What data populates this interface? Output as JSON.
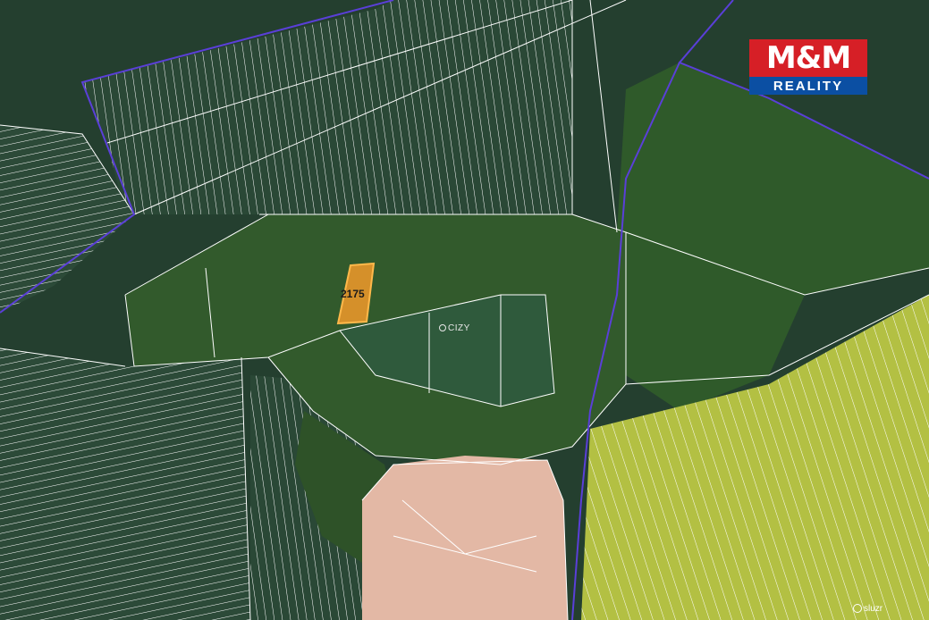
{
  "logo": {
    "line1": "M&M",
    "line2": "REALITY",
    "colors": {
      "red": "#d61f26",
      "blue": "#0b4fa3"
    }
  },
  "parcel": {
    "number": "2175",
    "highlight_color": "#f29a2a"
  },
  "place": {
    "name": "CIZY"
  },
  "credit": {
    "text": "sluzr"
  },
  "colors": {
    "cadastral_lines": "#ffffff",
    "boundary": "#5a3fd8",
    "forest": "#2f5a2a",
    "field_green": "#2b4a36",
    "rapeseed": "#b4c24a",
    "bare_field": "#e4b9a6"
  }
}
